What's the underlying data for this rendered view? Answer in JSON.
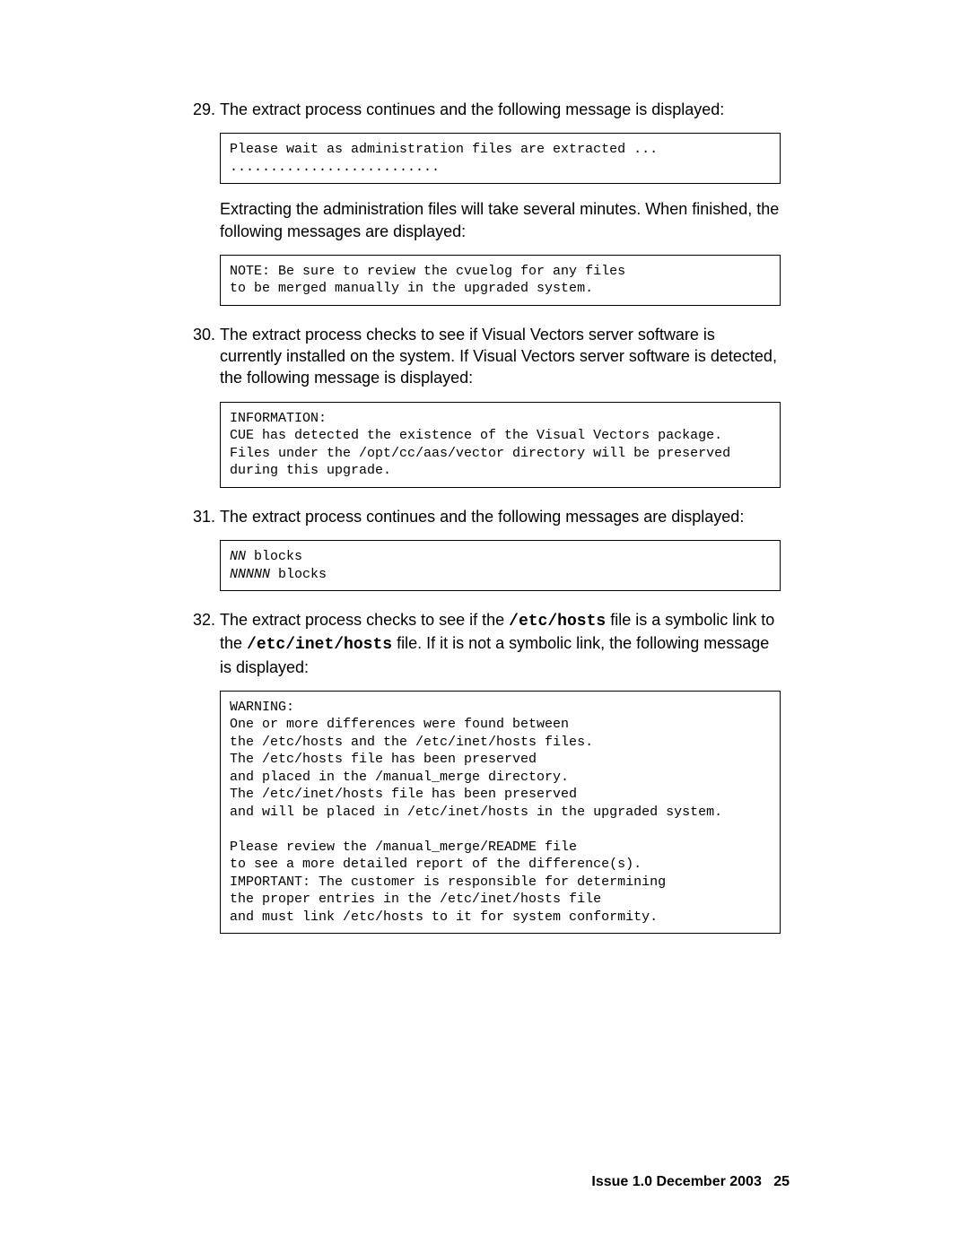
{
  "steps": {
    "s29": {
      "num": "29.",
      "text": "The extract process continues and the following message is displayed:",
      "code": "Please wait as administration files are extracted ...\n..........................",
      "subtext": "Extracting the administration files will take several minutes. When finished, the following messages are displayed:",
      "code2": "NOTE: Be sure to review the cvuelog for any files\nto be merged manually in the upgraded system."
    },
    "s30": {
      "num": "30.",
      "text": "The extract process checks to see if Visual Vectors server software is currently installed on the system. If Visual Vectors server software is detected, the following message is displayed:",
      "code": "INFORMATION:\nCUE has detected the existence of the Visual Vectors package.\nFiles under the /opt/cc/aas/vector directory will be preserved\nduring this upgrade."
    },
    "s31": {
      "num": "31.",
      "text": "The extract process continues and the following messages are displayed:",
      "code_pre_i1": "NN",
      "code_mid1": " blocks\n",
      "code_pre_i2": "NNNNN",
      "code_mid2": " blocks"
    },
    "s32": {
      "num": "32.",
      "text_a": "The extract process checks to see if the ",
      "path1": "/etc/hosts",
      "text_b": " file is a symbolic link to the ",
      "path2": "/etc/inet/hosts",
      "text_c": " file. If it is not a symbolic link, the following message is displayed:",
      "code": "WARNING:\nOne or more differences were found between\nthe /etc/hosts and the /etc/inet/hosts files.\nThe /etc/hosts file has been preserved\nand placed in the /manual_merge directory.\nThe /etc/inet/hosts file has been preserved\nand will be placed in /etc/inet/hosts in the upgraded system.\n\nPlease review the /manual_merge/README file\nto see a more detailed report of the difference(s).\nIMPORTANT: The customer is responsible for determining\nthe proper entries in the /etc/inet/hosts file\nand must link /etc/hosts to it for system conformity."
    }
  },
  "footer": {
    "issue": "Issue 1.0   December 2003",
    "page": "25"
  }
}
